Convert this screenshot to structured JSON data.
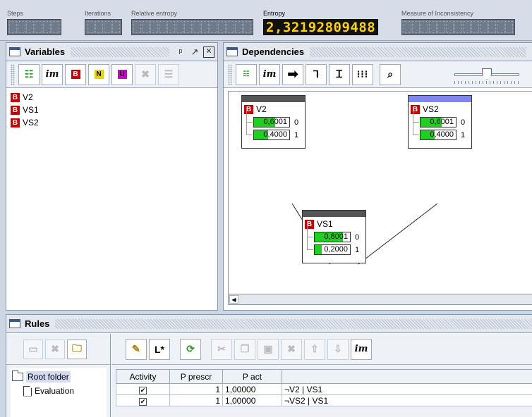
{
  "status": {
    "steps_label": "Steps",
    "iterations_label": "Iterations",
    "relative_entropy_label": "Relative entropy",
    "entropy_label": "Entropy",
    "entropy_value": "2,32192809488",
    "inconsistency_label": "Measure of Inconsistency"
  },
  "variables_panel": {
    "title": "Variables",
    "items": [
      {
        "badge": "B",
        "name": "V2"
      },
      {
        "badge": "B",
        "name": "VS1"
      },
      {
        "badge": "B",
        "name": "VS2"
      }
    ]
  },
  "dependencies_panel": {
    "title": "Dependencies",
    "zoom_level": 0.5,
    "nodes": [
      {
        "name": "V2",
        "header_color": "#555555",
        "states": [
          {
            "prob": "0,6001",
            "fill": 0.6,
            "value": "0"
          },
          {
            "prob": "0,4000",
            "fill": 0.4,
            "value": "1"
          }
        ]
      },
      {
        "name": "VS2",
        "header_color": "#7f86ee",
        "states": [
          {
            "prob": "0,6001",
            "fill": 0.6,
            "value": "0"
          },
          {
            "prob": "0,4000",
            "fill": 0.4,
            "value": "1"
          }
        ]
      },
      {
        "name": "VS1",
        "header_color": "#555555",
        "states": [
          {
            "prob": "0,8001",
            "fill": 0.8,
            "value": "0"
          },
          {
            "prob": "0,2000",
            "fill": 0.2,
            "value": "1"
          }
        ]
      }
    ]
  },
  "rules_panel": {
    "title": "Rules",
    "tree": [
      {
        "label": "Root folder",
        "icon": "folder-icon"
      },
      {
        "label": "Evaluation",
        "icon": "document-icon"
      }
    ],
    "table": {
      "headers": [
        "Activity",
        "P prescr",
        "P act",
        ""
      ],
      "rows": [
        {
          "activity": "✔",
          "p_prescr": "1",
          "p_act": "1,00000",
          "rule": "¬V2 | VS1"
        },
        {
          "activity": "✔",
          "p_prescr": "1",
          "p_act": "1,00000",
          "rule": "¬VS2 | VS1"
        }
      ]
    }
  },
  "toolbar": {
    "im_label": "im"
  },
  "colors": {
    "badge_red": "#cc0000",
    "probability_green": "#1fd01f",
    "entropy_digits": "#ffd400"
  }
}
